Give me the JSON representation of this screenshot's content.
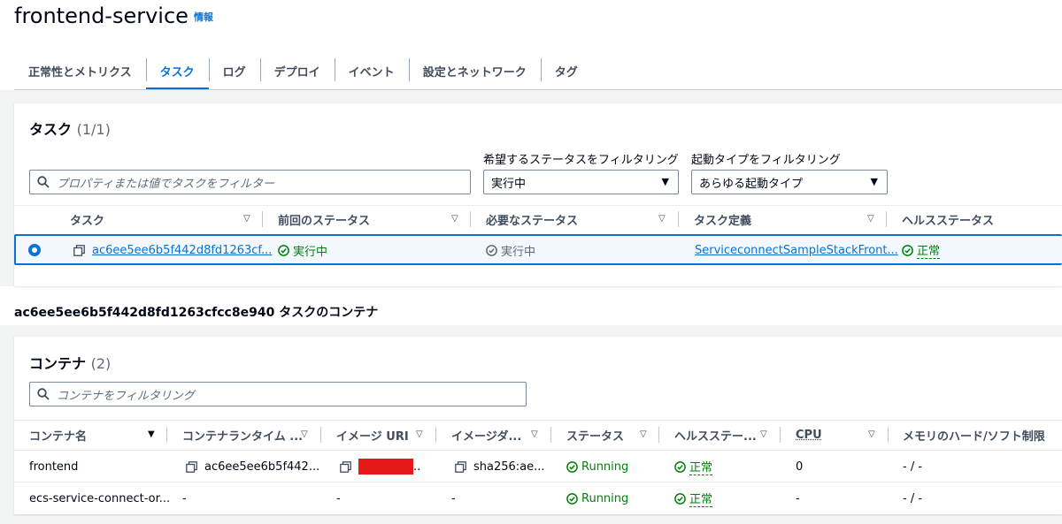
{
  "page": {
    "title": "frontend-service",
    "info_link": "情報"
  },
  "tabs": [
    {
      "label": "正常性とメトリクス",
      "active": false
    },
    {
      "label": "タスク",
      "active": true
    },
    {
      "label": "ログ",
      "active": false
    },
    {
      "label": "デプロイ",
      "active": false
    },
    {
      "label": "イベント",
      "active": false
    },
    {
      "label": "設定とネットワーク",
      "active": false
    },
    {
      "label": "タグ",
      "active": false
    }
  ],
  "tasks_panel": {
    "title": "タスク",
    "count": "(1/1)",
    "search_placeholder": "プロパティまたは値でタスクをフィルター",
    "desired_status_filter": {
      "label": "希望するステータスをフィルタリング",
      "value": "実行中"
    },
    "launch_type_filter": {
      "label": "起動タイプをフィルタリング",
      "value": "あらゆる起動タイプ"
    },
    "columns": [
      "タスク",
      "前回のステータス",
      "必要なステータス",
      "タスク定義",
      "ヘルスステータス"
    ],
    "rows": [
      {
        "selected": true,
        "task": "ac6ee5ee6b5f442d8fd1263cf...",
        "last_status": "実行中",
        "desired_status": "実行中",
        "task_definition": "ServiceconnectSampleStackFront...",
        "health": "正常"
      }
    ]
  },
  "containers_section": {
    "heading": "ac6ee5ee6b5f442d8fd1263cfcc8e940 タスクのコンテナ",
    "title": "コンテナ",
    "count": "(2)",
    "search_placeholder": "コンテナをフィルタリング",
    "columns": [
      "コンテナ名",
      "コンテナランタイム ...",
      "イメージ URI",
      "イメージダ...",
      "ステータス",
      "ヘルスステー...",
      "CPU",
      "メモリのハード/ソフト制限"
    ],
    "rows": [
      {
        "name": "frontend",
        "runtime": "ac6ee5ee6b5f442...",
        "image_uri_suffix": "..",
        "image_digest": "sha256:ae...",
        "status": "Running",
        "health": "正常",
        "cpu": "0",
        "memory": "- / -"
      },
      {
        "name": "ecs-service-connect-or...",
        "runtime": "-",
        "image_uri": "-",
        "image_digest": "-",
        "status": "Running",
        "health": "正常",
        "cpu": "-",
        "memory": "- / -"
      }
    ]
  },
  "colors": {
    "accent": "#0972d3",
    "success": "#037f0c",
    "redaction": "#e61919"
  }
}
